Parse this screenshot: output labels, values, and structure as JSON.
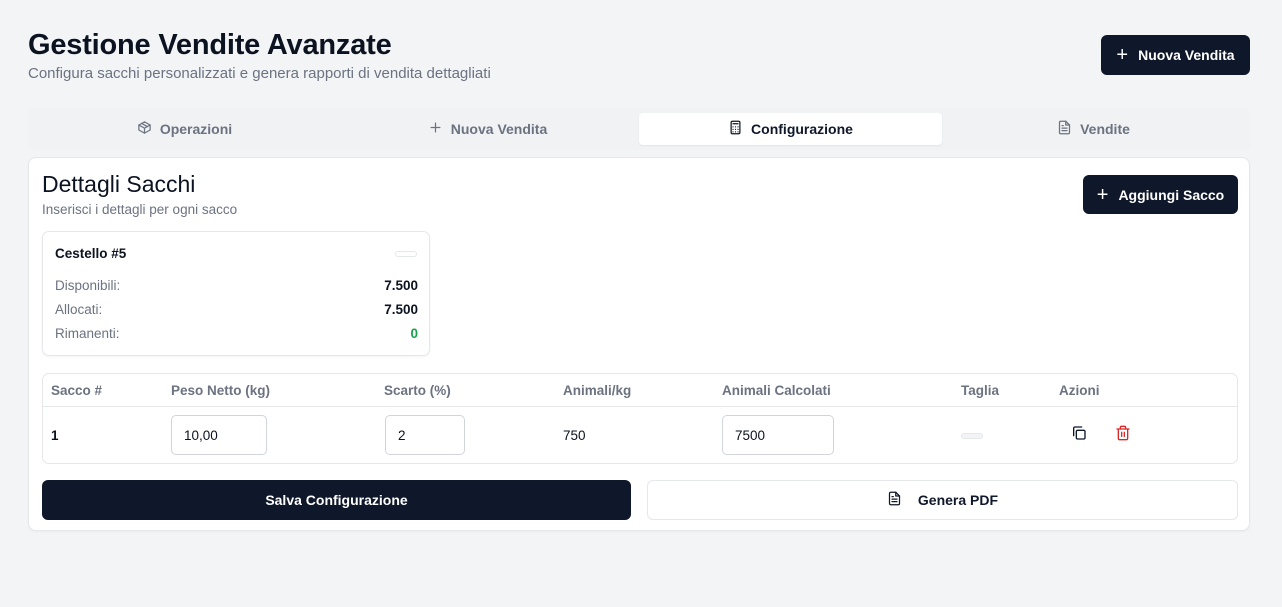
{
  "header": {
    "title": "Gestione Vendite Avanzate",
    "subtitle": "Configura sacchi personalizzati e genera rapporti di vendita dettagliati",
    "new_sale_label": "Nuova Vendita"
  },
  "tabs": [
    {
      "label": "Operazioni",
      "icon": "package-icon",
      "active": false
    },
    {
      "label": "Nuova Vendita",
      "icon": "plus-icon",
      "active": false
    },
    {
      "label": "Configurazione",
      "icon": "calculator-icon",
      "active": true
    },
    {
      "label": "Vendite",
      "icon": "document-icon",
      "active": false
    }
  ],
  "section": {
    "title": "Dettagli Sacchi",
    "subtitle": "Inserisci i dettagli per ogni sacco",
    "add_bag_label": "Aggiungi Sacco"
  },
  "basket": {
    "name": "Cestello #5",
    "stats": [
      {
        "label": "Disponibili:",
        "value": "7.500"
      },
      {
        "label": "Allocati:",
        "value": "7.500"
      },
      {
        "label": "Rimanenti:",
        "value": "0"
      }
    ]
  },
  "table": {
    "columns": [
      "Sacco #",
      "Peso Netto (kg)",
      "Scarto (%)",
      "Animali/kg",
      "Animali Calcolati",
      "Taglia",
      "Azioni"
    ],
    "rows": [
      {
        "sacco": "1",
        "peso_netto": "10,00",
        "scarto": "2",
        "animali_kg": "750",
        "animali_calcolati": "7500"
      }
    ]
  },
  "actions": {
    "save_label": "Salva Configurazione",
    "pdf_label": "Genera PDF"
  },
  "colors": {
    "primary": "#0f172a",
    "success": "#16a34a",
    "danger": "#dc2626",
    "background": "#f3f4f6"
  }
}
